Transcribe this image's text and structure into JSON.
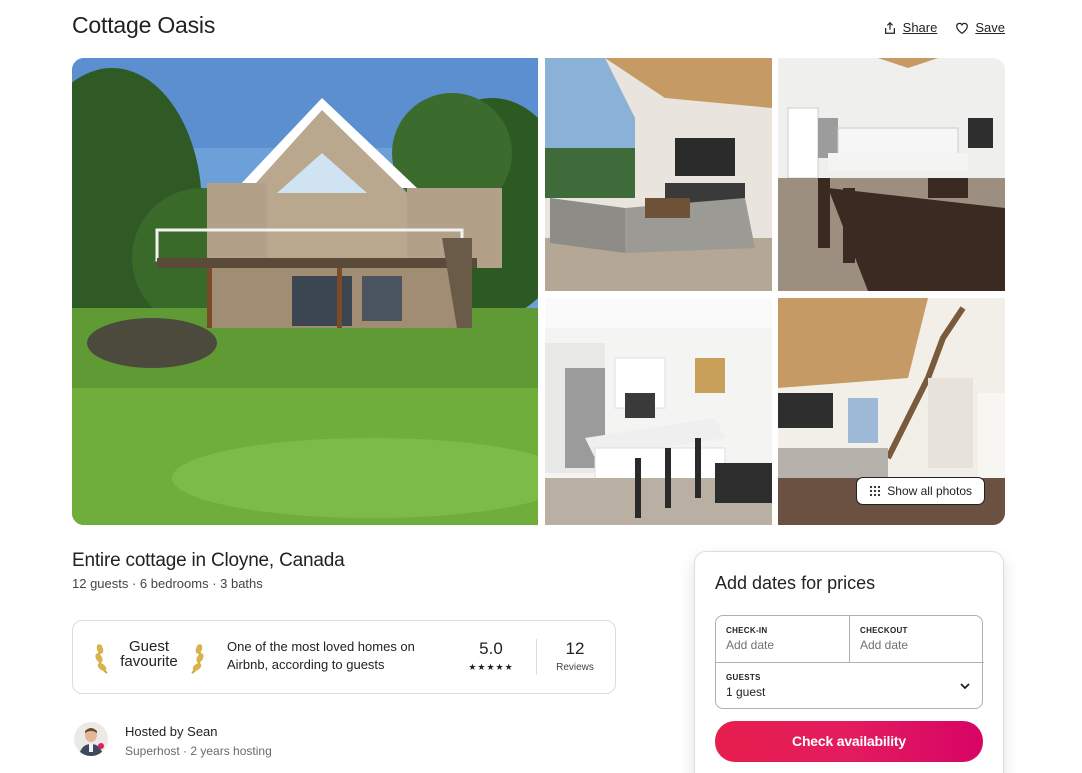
{
  "header": {
    "title": "Cottage Oasis",
    "share_label": "Share",
    "save_label": "Save"
  },
  "gallery": {
    "show_all_label": "Show all photos"
  },
  "listing": {
    "title": "Entire cottage in Cloyne, Canada",
    "details": "12 guests · 6 bedrooms · 3 baths"
  },
  "guest_favourite": {
    "badge_line1": "Guest",
    "badge_line2": "favourite",
    "description": "One of the most loved homes on Airbnb, according to guests",
    "rating": "5.0",
    "stars": "★★★★★",
    "reviews_count": "12",
    "reviews_label": "Reviews"
  },
  "host": {
    "name": "Hosted by Sean",
    "meta": "Superhost · 2 years hosting"
  },
  "booking": {
    "title": "Add dates for prices",
    "checkin_label": "CHECK-IN",
    "checkin_value": "Add date",
    "checkout_label": "CHECKOUT",
    "checkout_value": "Add date",
    "guests_label": "GUESTS",
    "guests_value": "1 guest",
    "cta_label": "Check availability",
    "cta_color": "#e31c5f"
  },
  "icons": [
    "share-icon",
    "heart-icon",
    "grid-icon",
    "laurel-icon",
    "chevron-down-icon"
  ]
}
